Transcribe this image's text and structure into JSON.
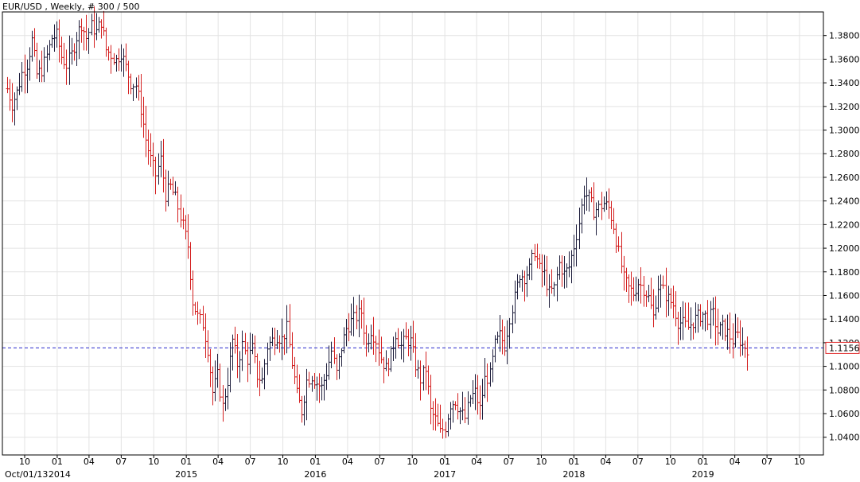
{
  "chart_title": "EUR/USD , Weekly, # 300 / 500",
  "current_price_label": "1.1156",
  "colors": {
    "background": "#ffffff",
    "grid": "#e3e3e3",
    "frame": "#000000",
    "up_bar": "#1e1e3c",
    "down_bar": "#d42020",
    "price_line": "#2a2acc",
    "price_box_border": "#e03030"
  },
  "chart_data": {
    "type": "ohlc",
    "title": "EUR/USD , Weekly, # 300 / 500",
    "interval": "Weekly",
    "bars_shown": "300 / 500",
    "grid": true,
    "ylim": [
      1.025,
      1.4
    ],
    "y_ticks": [
      "1.0400",
      "1.0600",
      "1.0800",
      "1.1000",
      "1.1200",
      "1.1400",
      "1.1600",
      "1.1800",
      "1.2000",
      "1.2200",
      "1.2400",
      "1.2600",
      "1.2800",
      "1.3000",
      "1.3200",
      "1.3400",
      "1.3600",
      "1.3800"
    ],
    "x_ticks": [
      {
        "date": "2013-10-01",
        "label": "10",
        "sublabel": "Oct/01/13"
      },
      {
        "date": "2014-01-01",
        "label": "01",
        "sublabel": "2014"
      },
      {
        "date": "2014-04-01",
        "label": "04",
        "sublabel": ""
      },
      {
        "date": "2014-07-01",
        "label": "07",
        "sublabel": ""
      },
      {
        "date": "2014-10-01",
        "label": "10",
        "sublabel": ""
      },
      {
        "date": "2015-01-01",
        "label": "01",
        "sublabel": "2015"
      },
      {
        "date": "2015-04-01",
        "label": "04",
        "sublabel": ""
      },
      {
        "date": "2015-07-01",
        "label": "07",
        "sublabel": ""
      },
      {
        "date": "2015-10-01",
        "label": "10",
        "sublabel": ""
      },
      {
        "date": "2016-01-01",
        "label": "01",
        "sublabel": "2016"
      },
      {
        "date": "2016-04-01",
        "label": "04",
        "sublabel": ""
      },
      {
        "date": "2016-07-01",
        "label": "07",
        "sublabel": ""
      },
      {
        "date": "2016-10-01",
        "label": "10",
        "sublabel": ""
      },
      {
        "date": "2017-01-01",
        "label": "01",
        "sublabel": "2017"
      },
      {
        "date": "2017-04-01",
        "label": "04",
        "sublabel": ""
      },
      {
        "date": "2017-07-01",
        "label": "07",
        "sublabel": ""
      },
      {
        "date": "2017-10-01",
        "label": "10",
        "sublabel": ""
      },
      {
        "date": "2018-01-01",
        "label": "01",
        "sublabel": "2018"
      },
      {
        "date": "2018-04-01",
        "label": "04",
        "sublabel": ""
      },
      {
        "date": "2018-07-01",
        "label": "07",
        "sublabel": ""
      },
      {
        "date": "2018-10-01",
        "label": "10",
        "sublabel": ""
      },
      {
        "date": "2019-01-01",
        "label": "01",
        "sublabel": "2019"
      },
      {
        "date": "2019-04-01",
        "label": "04",
        "sublabel": ""
      },
      {
        "date": "2019-07-01",
        "label": "07",
        "sublabel": ""
      },
      {
        "date": "2019-10-01",
        "label": "10",
        "sublabel": ""
      }
    ],
    "current_price": 1.1156,
    "weekly_path": [
      [
        "2013-08-12",
        1.335
      ],
      [
        "2013-08-26",
        1.322
      ],
      [
        "2013-09-09",
        1.332
      ],
      [
        "2013-09-23",
        1.348
      ],
      [
        "2013-10-07",
        1.356
      ],
      [
        "2013-10-21",
        1.376
      ],
      [
        "2013-11-04",
        1.347
      ],
      [
        "2013-11-18",
        1.351
      ],
      [
        "2013-12-02",
        1.363
      ],
      [
        "2013-12-16",
        1.378
      ],
      [
        "2013-12-30",
        1.38
      ],
      [
        "2014-01-13",
        1.362
      ],
      [
        "2014-01-27",
        1.355
      ],
      [
        "2014-02-10",
        1.364
      ],
      [
        "2014-02-24",
        1.379
      ],
      [
        "2014-03-10",
        1.39
      ],
      [
        "2014-03-24",
        1.378
      ],
      [
        "2014-04-07",
        1.388
      ],
      [
        "2014-04-21",
        1.383
      ],
      [
        "2014-05-05",
        1.392
      ],
      [
        "2014-05-19",
        1.368
      ],
      [
        "2014-06-02",
        1.364
      ],
      [
        "2014-06-16",
        1.359
      ],
      [
        "2014-06-30",
        1.366
      ],
      [
        "2014-07-14",
        1.353
      ],
      [
        "2014-07-28",
        1.34
      ],
      [
        "2014-08-11",
        1.338
      ],
      [
        "2014-08-25",
        1.318
      ],
      [
        "2014-09-08",
        1.292
      ],
      [
        "2014-09-22",
        1.275
      ],
      [
        "2014-10-06",
        1.262
      ],
      [
        "2014-10-20",
        1.275
      ],
      [
        "2014-11-03",
        1.245
      ],
      [
        "2014-11-17",
        1.252
      ],
      [
        "2014-12-01",
        1.242
      ],
      [
        "2014-12-15",
        1.227
      ],
      [
        "2015-01-05",
        1.202
      ],
      [
        "2015-01-19",
        1.155
      ],
      [
        "2015-02-02",
        1.142
      ],
      [
        "2015-02-16",
        1.136
      ],
      [
        "2015-03-02",
        1.115
      ],
      [
        "2015-03-16",
        1.078
      ],
      [
        "2015-03-30",
        1.092
      ],
      [
        "2015-04-13",
        1.066
      ],
      [
        "2015-04-27",
        1.088
      ],
      [
        "2015-05-11",
        1.122
      ],
      [
        "2015-05-25",
        1.102
      ],
      [
        "2015-06-08",
        1.118
      ],
      [
        "2015-06-22",
        1.106
      ],
      [
        "2015-07-06",
        1.115
      ],
      [
        "2015-07-20",
        1.092
      ],
      [
        "2015-08-03",
        1.088
      ],
      [
        "2015-08-17",
        1.117
      ],
      [
        "2015-08-31",
        1.122
      ],
      [
        "2015-09-14",
        1.126
      ],
      [
        "2015-09-28",
        1.123
      ],
      [
        "2015-10-12",
        1.132
      ],
      [
        "2015-10-26",
        1.103
      ],
      [
        "2015-11-09",
        1.076
      ],
      [
        "2015-11-23",
        1.062
      ],
      [
        "2015-12-07",
        1.088
      ],
      [
        "2015-12-21",
        1.092
      ],
      [
        "2016-01-04",
        1.086
      ],
      [
        "2016-01-18",
        1.082
      ],
      [
        "2016-02-01",
        1.095
      ],
      [
        "2016-02-15",
        1.113
      ],
      [
        "2016-02-29",
        1.094
      ],
      [
        "2016-03-14",
        1.116
      ],
      [
        "2016-03-28",
        1.132
      ],
      [
        "2016-04-11",
        1.138
      ],
      [
        "2016-04-25",
        1.142
      ],
      [
        "2016-05-09",
        1.146
      ],
      [
        "2016-05-23",
        1.118
      ],
      [
        "2016-06-06",
        1.131
      ],
      [
        "2016-06-20",
        1.122
      ],
      [
        "2016-07-04",
        1.107
      ],
      [
        "2016-07-18",
        1.098
      ],
      [
        "2016-08-01",
        1.109
      ],
      [
        "2016-08-15",
        1.128
      ],
      [
        "2016-08-29",
        1.117
      ],
      [
        "2016-09-12",
        1.123
      ],
      [
        "2016-09-26",
        1.121
      ],
      [
        "2016-10-10",
        1.101
      ],
      [
        "2016-10-24",
        1.089
      ],
      [
        "2016-11-07",
        1.098
      ],
      [
        "2016-11-21",
        1.062
      ],
      [
        "2016-12-05",
        1.055
      ],
      [
        "2016-12-19",
        1.044
      ],
      [
        "2017-01-02",
        1.049
      ],
      [
        "2017-01-16",
        1.068
      ],
      [
        "2017-01-30",
        1.071
      ],
      [
        "2017-02-13",
        1.062
      ],
      [
        "2017-02-27",
        1.056
      ],
      [
        "2017-03-13",
        1.073
      ],
      [
        "2017-03-27",
        1.078
      ],
      [
        "2017-04-10",
        1.064
      ],
      [
        "2017-04-24",
        1.089
      ],
      [
        "2017-05-08",
        1.092
      ],
      [
        "2017-05-22",
        1.118
      ],
      [
        "2017-06-05",
        1.126
      ],
      [
        "2017-06-19",
        1.118
      ],
      [
        "2017-07-03",
        1.142
      ],
      [
        "2017-07-17",
        1.158
      ],
      [
        "2017-07-31",
        1.178
      ],
      [
        "2017-08-14",
        1.176
      ],
      [
        "2017-08-28",
        1.182
      ],
      [
        "2017-09-11",
        1.198
      ],
      [
        "2017-09-25",
        1.182
      ],
      [
        "2017-10-09",
        1.178
      ],
      [
        "2017-10-23",
        1.162
      ],
      [
        "2017-11-06",
        1.166
      ],
      [
        "2017-11-20",
        1.187
      ],
      [
        "2017-12-04",
        1.178
      ],
      [
        "2017-12-18",
        1.184
      ],
      [
        "2018-01-01",
        1.202
      ],
      [
        "2018-01-15",
        1.222
      ],
      [
        "2018-01-29",
        1.248
      ],
      [
        "2018-02-12",
        1.242
      ],
      [
        "2018-02-26",
        1.232
      ],
      [
        "2018-03-12",
        1.234
      ],
      [
        "2018-03-26",
        1.238
      ],
      [
        "2018-04-09",
        1.234
      ],
      [
        "2018-04-23",
        1.219
      ],
      [
        "2018-05-07",
        1.196
      ],
      [
        "2018-05-21",
        1.174
      ],
      [
        "2018-06-04",
        1.166
      ],
      [
        "2018-06-18",
        1.162
      ],
      [
        "2018-07-02",
        1.171
      ],
      [
        "2018-07-16",
        1.166
      ],
      [
        "2018-07-30",
        1.158
      ],
      [
        "2018-08-13",
        1.142
      ],
      [
        "2018-08-27",
        1.168
      ],
      [
        "2018-09-10",
        1.164
      ],
      [
        "2018-09-24",
        1.157
      ],
      [
        "2018-10-08",
        1.152
      ],
      [
        "2018-10-22",
        1.138
      ],
      [
        "2018-11-05",
        1.136
      ],
      [
        "2018-11-19",
        1.133
      ],
      [
        "2018-12-03",
        1.138
      ],
      [
        "2018-12-17",
        1.142
      ],
      [
        "2018-12-31",
        1.144
      ],
      [
        "2019-01-14",
        1.141
      ],
      [
        "2019-01-28",
        1.144
      ],
      [
        "2019-02-11",
        1.129
      ],
      [
        "2019-02-25",
        1.133
      ],
      [
        "2019-03-11",
        1.128
      ],
      [
        "2019-03-25",
        1.122
      ],
      [
        "2019-04-08",
        1.126
      ],
      [
        "2019-04-22",
        1.118
      ],
      [
        "2019-05-06",
        1.1156
      ]
    ]
  }
}
